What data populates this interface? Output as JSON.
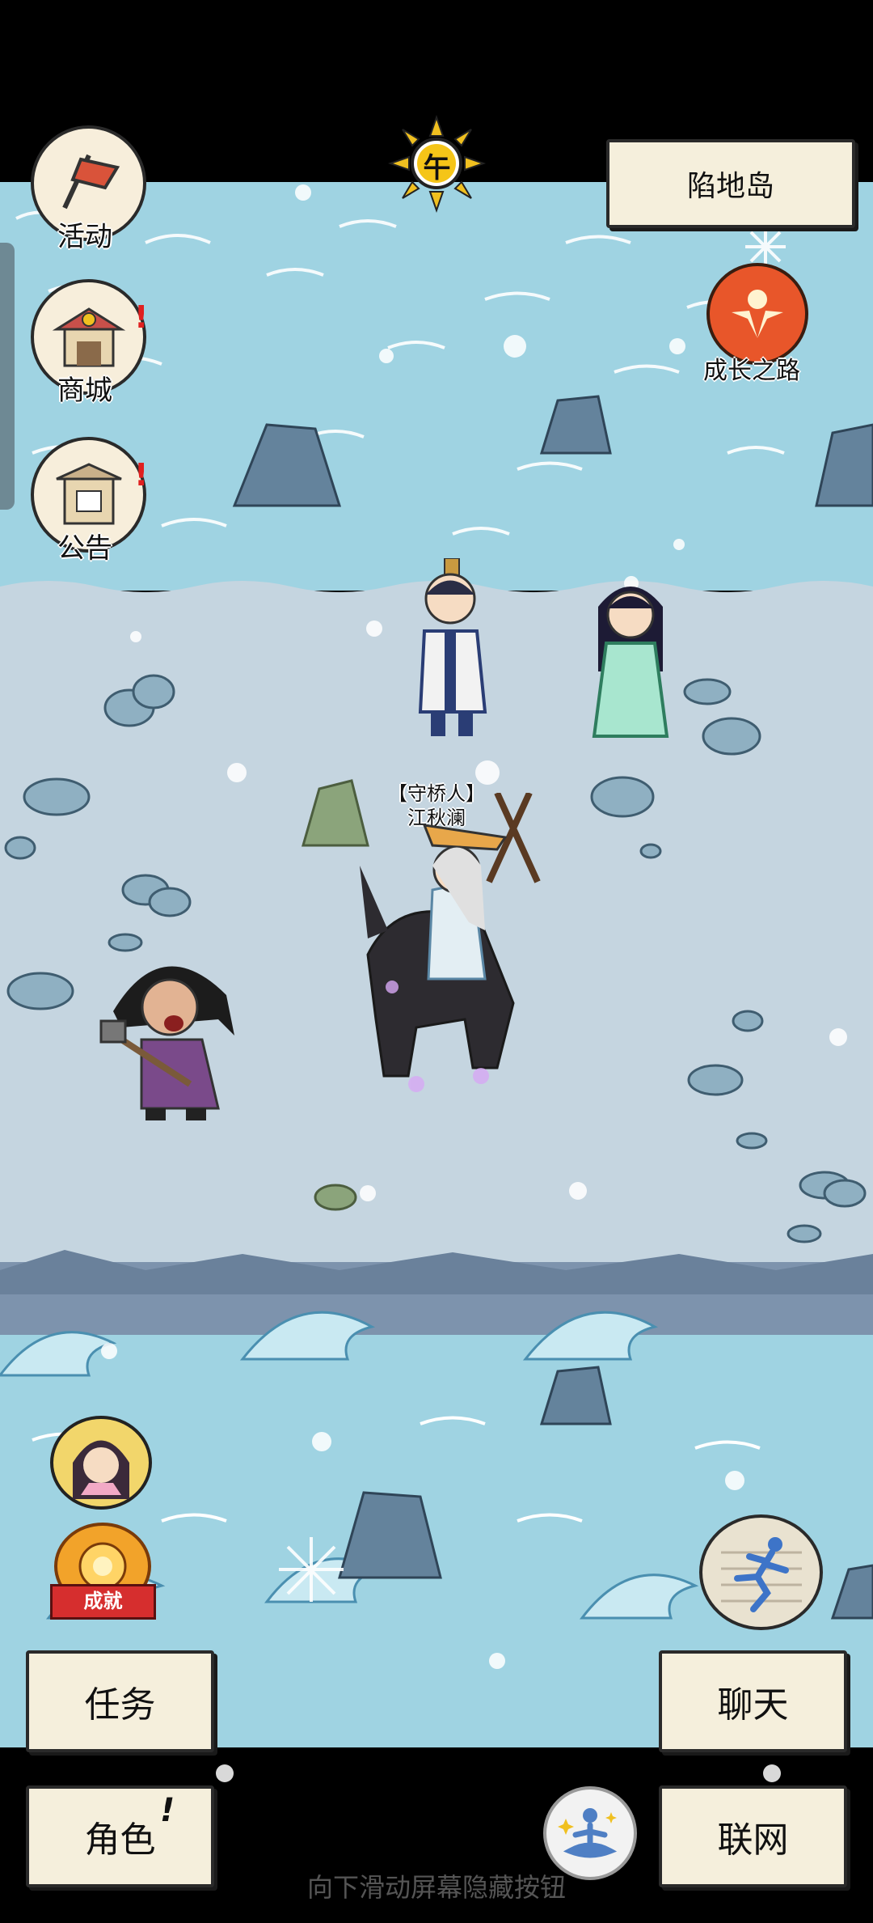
{
  "time_of_day": "午",
  "location_name": "陷地岛",
  "left_menu": [
    {
      "label": "活动",
      "icon": "flag-icon"
    },
    {
      "label": "商城",
      "icon": "shop-icon",
      "alert": "!"
    },
    {
      "label": "公告",
      "icon": "notice-board-icon",
      "alert": "!"
    }
  ],
  "growth_path": {
    "label": "成长之路",
    "icon": "growth-icon"
  },
  "npc": {
    "title": "【守桥人】",
    "name": "江秋澜"
  },
  "achievement": {
    "label": "成就"
  },
  "buttons": {
    "task": "任务",
    "chat": "聊天",
    "character": "角色",
    "character_alert": "!",
    "network": "联网"
  },
  "hint": "向下滑动屏幕隐藏按钮",
  "colors": {
    "sea": "#9fd3e2",
    "land": "#c5d5e0",
    "button_bg": "#f5efdc",
    "alert": "#e02020"
  }
}
